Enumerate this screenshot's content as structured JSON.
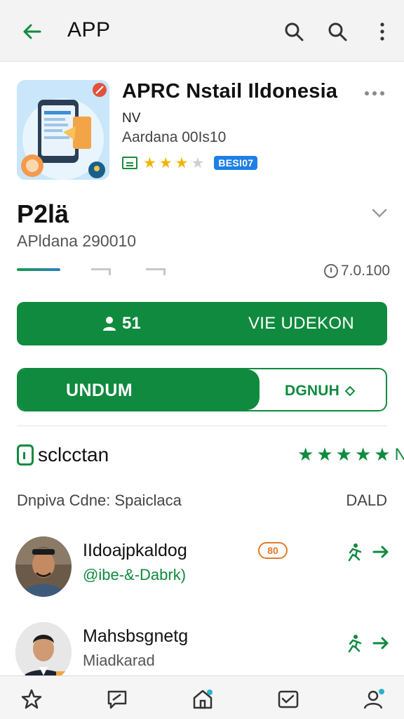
{
  "header": {
    "title": "APP",
    "back_icon": "arrow-left-icon",
    "search_icons": [
      "search-icon",
      "search-icon"
    ],
    "more_icon": "more-vert-icon"
  },
  "app": {
    "name": "APRC Nstail Ildonesia",
    "developer": "NV",
    "subtitle": "Aardana 00Is10",
    "rating_stars": 3,
    "rating_max": 5,
    "badge": "BESI07"
  },
  "version": {
    "title": "P2lä",
    "subtitle": "APldana 290010",
    "number": "7.0.100"
  },
  "actions": {
    "primary_count": "51",
    "primary_label": "VIE UDEKON",
    "split_fill_label": "UNDUM",
    "split_outline_label": "DGNUH"
  },
  "reviews": {
    "heading": "sclcctan",
    "stars": 5,
    "stars_suffix": "N",
    "filter_left": "Dnpiva Cdne: Spaiclaca",
    "filter_right": "DALD",
    "items": [
      {
        "name": "IIdoajpkaldog",
        "meta": "@ibe-&-Dabrk)",
        "meta_style": "green",
        "coin": "80"
      },
      {
        "name": "Mahsbsgnetg",
        "meta": "Miadkarad",
        "meta_style": "grey",
        "coin": ""
      }
    ]
  },
  "colors": {
    "accent": "#0f8a3e",
    "star": "#f2b400",
    "badge": "#1e7fe6"
  },
  "bottom_nav": [
    "star-icon",
    "chat-icon",
    "home-icon",
    "inbox-icon",
    "profile-icon"
  ]
}
